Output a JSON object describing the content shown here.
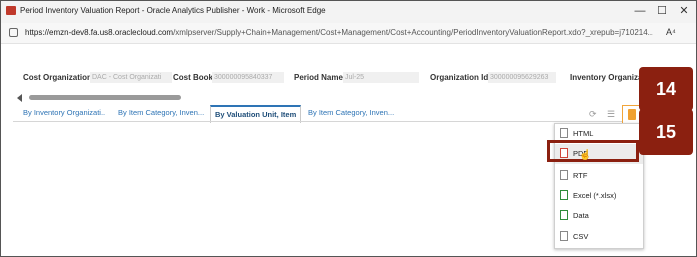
{
  "window": {
    "title": "Period Inventory Valuation Report - Oracle Analytics Publisher - Work - Microsoft Edge",
    "minimize": "—",
    "maximize": "☐",
    "close": "✕"
  },
  "address": {
    "url_host": "https://emzn-dev8.fa.us8.oraclecloud.com",
    "url_path": "/xmlpserver/Supply+Chain+Management/Cost+Management/Cost+Accounting/PeriodInventoryValuationReport.xdo?_xrepub=j710214...",
    "reader": "A⁴"
  },
  "params": [
    {
      "label": "Cost Organization",
      "value": "DAC - Cost Organizati"
    },
    {
      "label": "Cost Book",
      "value": "300000095840337"
    },
    {
      "label": "Period Name",
      "value": "Jul-25"
    },
    {
      "label": "Organization Id",
      "value": "300000095629263"
    },
    {
      "label": "Inventory Organiza",
      "value": ""
    }
  ],
  "tabs": [
    {
      "label": "By Inventory Organizati..."
    },
    {
      "label": "By Item Category, Inven..."
    },
    {
      "label": "By Valuation Unit, Item"
    },
    {
      "label": "By Item Category, Inven..."
    }
  ],
  "toolbar": {
    "refresh": "⟳",
    "list": "☰"
  },
  "export_menu": [
    {
      "label": "HTML"
    },
    {
      "label": "PDF"
    },
    {
      "label": "RTF"
    },
    {
      "label": "Excel (*.xlsx)"
    },
    {
      "label": "Data"
    },
    {
      "label": "CSV"
    }
  ],
  "callouts": {
    "step14": "14",
    "step15": "15"
  },
  "colors": {
    "accent": "#2e74b5",
    "callout": "#8b2010",
    "export": "#f0a030"
  }
}
